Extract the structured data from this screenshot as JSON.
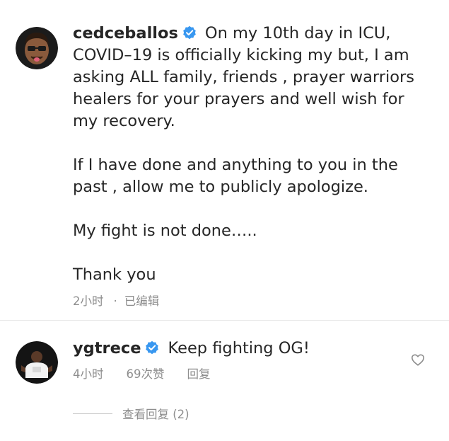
{
  "post": {
    "username": "cedceballos",
    "caption": "On my 10th day in ICU, COVID–19 is officially kicking my but, I am asking ALL family, friends , prayer warriors healers for your prayers and well wish for my recovery.\n\nIf I have done and anything to you in the past , allow me to publicly apologize.\n\nMy fight is not done…..\n\nThank you",
    "time": "2小时",
    "separator": "·",
    "edited": "已编辑"
  },
  "comment": {
    "username": "ygtrece",
    "text": "Keep fighting OG!",
    "time": "4小时",
    "likes": "69次赞",
    "reply_label": "回复",
    "view_replies": "查看回复 (2)"
  },
  "icons": {
    "verified": "verified-badge-icon",
    "like": "heart-icon"
  },
  "colors": {
    "verified_blue": "#3897f0",
    "text": "#262626",
    "muted": "#8e8e8e"
  }
}
